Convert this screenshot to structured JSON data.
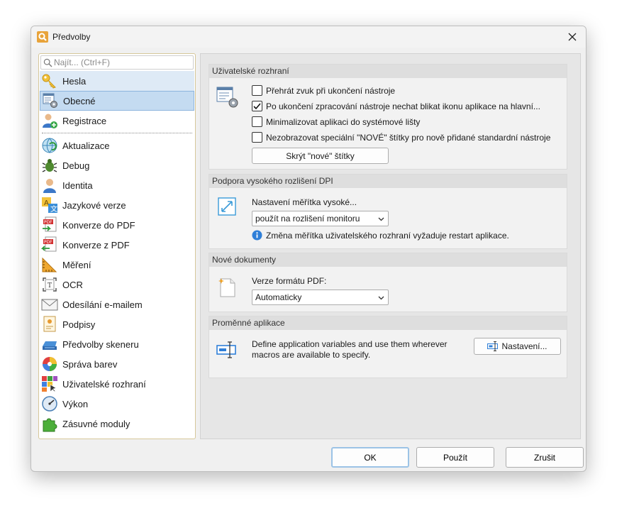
{
  "window": {
    "title": "Předvolby"
  },
  "search": {
    "placeholder": "Najít... (Ctrl+F)"
  },
  "sidebar": {
    "items": [
      {
        "label": "Hesla",
        "icon": "key-icon"
      },
      {
        "label": "Obecné",
        "icon": "general-settings-icon"
      },
      {
        "label": "Registrace",
        "icon": "registration-icon"
      },
      {
        "label": "Aktualizace",
        "icon": "globe-update-icon"
      },
      {
        "label": "Debug",
        "icon": "bug-icon"
      },
      {
        "label": "Identita",
        "icon": "identity-icon"
      },
      {
        "label": "Jazykové verze",
        "icon": "language-icon"
      },
      {
        "label": "Konverze do PDF",
        "icon": "convert-to-pdf-icon"
      },
      {
        "label": "Konverze z PDF",
        "icon": "convert-from-pdf-icon"
      },
      {
        "label": "Měření",
        "icon": "ruler-icon"
      },
      {
        "label": "OCR",
        "icon": "ocr-icon"
      },
      {
        "label": "Odesílání e-mailem",
        "icon": "email-icon"
      },
      {
        "label": "Podpisy",
        "icon": "signature-icon"
      },
      {
        "label": "Předvolby skeneru",
        "icon": "scanner-icon"
      },
      {
        "label": "Správa barev",
        "icon": "color-wheel-icon"
      },
      {
        "label": "Uživatelské rozhraní",
        "icon": "ui-icon"
      },
      {
        "label": "Výkon",
        "icon": "gauge-icon"
      },
      {
        "label": "Zásuvné moduly",
        "icon": "puzzle-icon"
      }
    ]
  },
  "ui_section": {
    "title": "Uživatelské rozhraní",
    "checkboxes": [
      {
        "label": "Přehrát zvuk při ukončení nástroje",
        "checked": false
      },
      {
        "label": "Po ukončení zpracování nástroje nechat blikat ikonu aplikace na hlavní...",
        "checked": true
      },
      {
        "label": "Minimalizovat aplikaci do systémové lišty",
        "checked": false
      },
      {
        "label": "Nezobrazovat speciální \"NOVÉ\" štítky pro nově přidané standardní nástroje",
        "checked": false
      }
    ],
    "hide_labels_button": "Skrýt \"nové\" štítky"
  },
  "dpi_section": {
    "title": "Podpora vysokého rozlišení DPI",
    "label": "Nastavení měřítka vysoké...",
    "select_value": "použít na rozlišení monitoru",
    "info": "Změna měřítka uživatelského rozhraní vyžaduje restart aplikace."
  },
  "docs_section": {
    "title": "Nové dokumenty",
    "label": "Verze formátu PDF:",
    "select_value": "Automaticky"
  },
  "vars_section": {
    "title": "Proměnné aplikace",
    "line1": "Define application variables and use them wherever",
    "line2": "macros are available to specify.",
    "button": "Nastavení..."
  },
  "footer": {
    "ok": "OK",
    "apply": "Použít",
    "cancel": "Zrušit"
  }
}
